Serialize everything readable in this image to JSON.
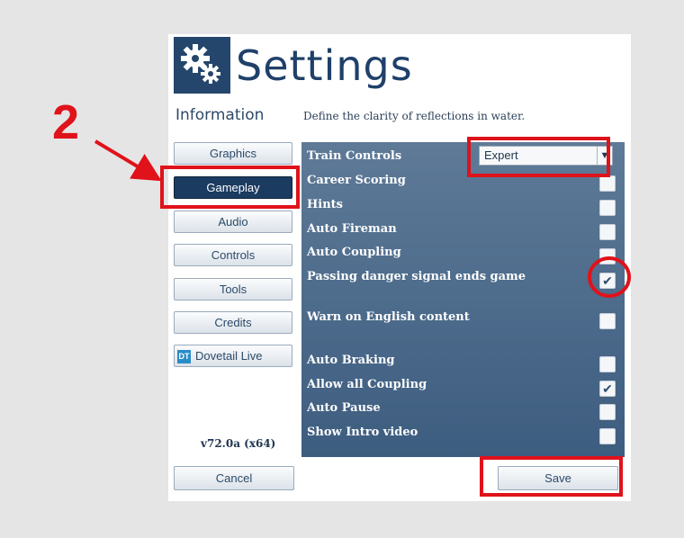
{
  "header": {
    "title": "Settings",
    "info_label": "Information",
    "description": "Define the clarity of reflections in water."
  },
  "nav": {
    "items": [
      {
        "label": "Graphics",
        "active": false
      },
      {
        "label": "Gameplay",
        "active": true
      },
      {
        "label": "Audio",
        "active": false
      },
      {
        "label": "Controls",
        "active": false
      },
      {
        "label": "Tools",
        "active": false
      },
      {
        "label": "Credits",
        "active": false
      },
      {
        "label": "Dovetail Live",
        "active": false,
        "icon": "dovetail-live-icon",
        "icon_text": "DT"
      }
    ]
  },
  "version": "v72.0a (x64)",
  "options": {
    "train_controls": {
      "label": "Train Controls",
      "value": "Expert"
    },
    "items": [
      {
        "label": "Career Scoring",
        "checked": false
      },
      {
        "label": "Hints",
        "checked": false
      },
      {
        "label": "Auto Fireman",
        "checked": false
      },
      {
        "label": "Auto Coupling",
        "checked": false
      },
      {
        "label": "Passing danger signal ends game",
        "checked": true
      },
      {
        "label": "Warn on English content",
        "checked": false
      },
      {
        "label": "Auto Braking",
        "checked": false
      },
      {
        "label": "Allow all Coupling",
        "checked": true
      },
      {
        "label": "Auto Pause",
        "checked": false
      },
      {
        "label": "Show Intro video",
        "checked": false
      }
    ]
  },
  "buttons": {
    "cancel": "Cancel",
    "save": "Save"
  },
  "annotation": {
    "number": "2",
    "color": "#e0121a"
  },
  "colors": {
    "accent": "#25466c",
    "panel": "#4a6a8c",
    "active_nav": "#1b3b60"
  }
}
